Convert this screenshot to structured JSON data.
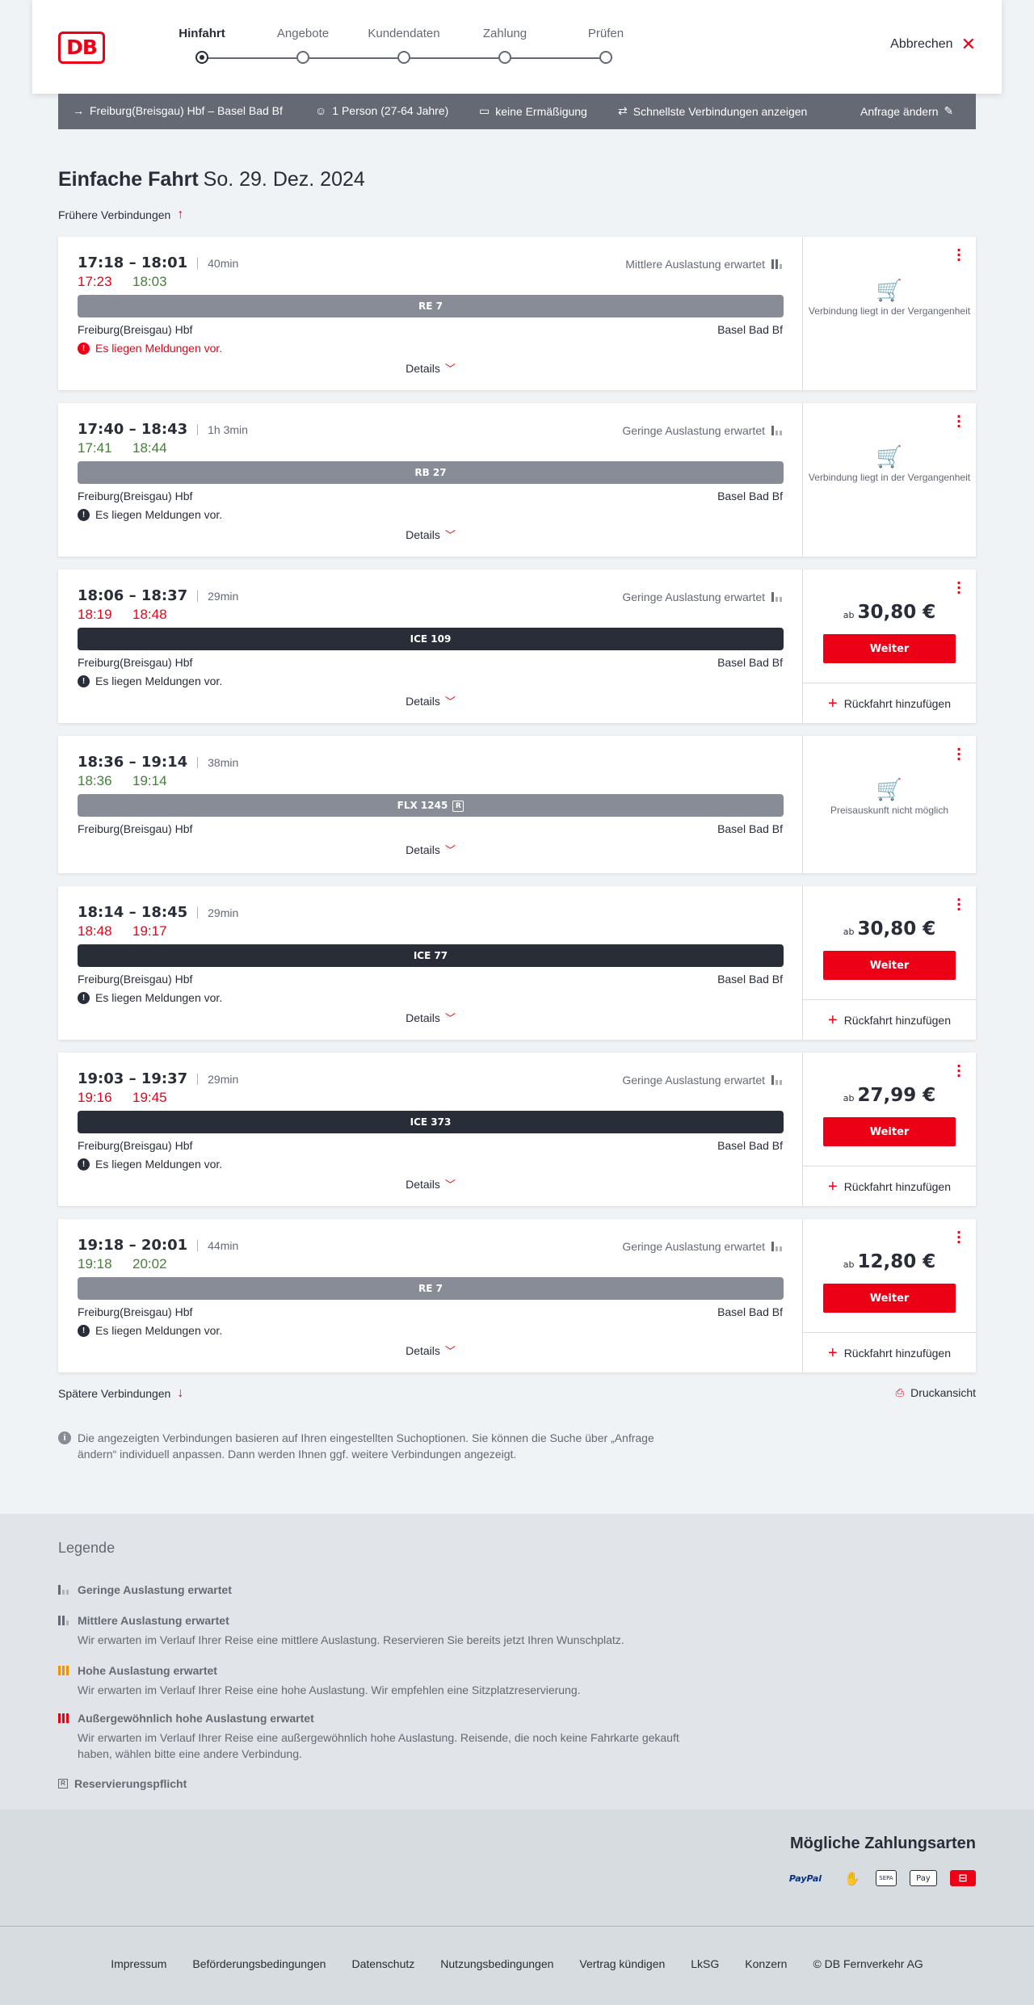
{
  "header": {
    "logo": "DB",
    "steps": [
      {
        "label": "Hinfahrt",
        "active": true
      },
      {
        "label": "Angebote",
        "active": false
      },
      {
        "label": "Kundendaten",
        "active": false
      },
      {
        "label": "Zahlung",
        "active": false
      },
      {
        "label": "Prüfen",
        "active": false
      }
    ],
    "cancel_label": "Abbrechen"
  },
  "summary": {
    "route": "Freiburg(Breisgau) Hbf – Basel Bad Bf",
    "persons": "1 Person (27-64 Jahre)",
    "discount": "keine Ermäßigung",
    "fastest": "Schnellste Verbindungen anzeigen",
    "change": "Anfrage ändern"
  },
  "title": {
    "type": "Einfache Fahrt",
    "date": "So. 29. Dez. 2024"
  },
  "earlier_label": "Frühere Verbindungen",
  "later_label": "Spätere Verbindungen",
  "print_label": "Druckansicht",
  "info_text": "Die angezeigten Verbindungen basieren auf Ihren eingestellten Suchoptionen. Sie können die Suche über „Anfrage ändern“ individuell anpassen. Dann werden Ihnen ggf. weitere Verbindungen angezeigt.",
  "common": {
    "details": "Details",
    "from": "Freiburg(Breisgau) Hbf",
    "to": "Basel Bad Bf",
    "message": "Es liegen Meldungen vor.",
    "ab": "ab",
    "weiter": "Weiter",
    "return": "Rückfahrt hinzufügen"
  },
  "connections": [
    {
      "times": "17:18 – 18:01",
      "duration": "40min",
      "rt_dep": "17:23",
      "rt_arr": "18:03",
      "dep_color": "red",
      "arr_color": "green",
      "load": "Mittlere Auslastung erwartet",
      "train": "RE 7",
      "train_style": "grey",
      "msg": true,
      "msg_alert": true,
      "status": "past",
      "status_text": "Verbindung liegt in der Vergangenheit"
    },
    {
      "times": "17:40 – 18:43",
      "duration": "1h 3min",
      "rt_dep": "17:41",
      "rt_arr": "18:44",
      "dep_color": "green",
      "arr_color": "green",
      "load": "Geringe Auslastung erwartet",
      "train": "RB 27",
      "train_style": "grey",
      "msg": true,
      "msg_alert": false,
      "status": "past",
      "status_text": "Verbindung liegt in der Vergangenheit"
    },
    {
      "times": "18:06 – 18:37",
      "duration": "29min",
      "rt_dep": "18:19",
      "rt_arr": "18:48",
      "dep_color": "red",
      "arr_color": "red",
      "load": "Geringe Auslastung erwartet",
      "train": "ICE 109",
      "train_style": "dark",
      "msg": true,
      "msg_alert": false,
      "status": "price",
      "price": "30,80 €"
    },
    {
      "times": "18:36 – 19:14",
      "duration": "38min",
      "rt_dep": "18:36",
      "rt_arr": "19:14",
      "dep_color": "green",
      "arr_color": "green",
      "load": "",
      "train": "FLX 1245",
      "train_style": "grey",
      "reservation": "R",
      "msg": false,
      "status": "past",
      "status_text": "Preisauskunft nicht möglich"
    },
    {
      "times": "18:14 – 18:45",
      "duration": "29min",
      "rt_dep": "18:48",
      "rt_arr": "19:17",
      "dep_color": "red",
      "arr_color": "red",
      "load": "",
      "train": "ICE 77",
      "train_style": "dark",
      "msg": true,
      "msg_alert": false,
      "status": "price",
      "price": "30,80 €"
    },
    {
      "times": "19:03 – 19:37",
      "duration": "29min",
      "rt_dep": "19:16",
      "rt_arr": "19:45",
      "dep_color": "red",
      "arr_color": "red",
      "load": "Geringe Auslastung erwartet",
      "train": "ICE 373",
      "train_style": "dark",
      "msg": true,
      "msg_alert": false,
      "status": "price",
      "price": "27,99 €"
    },
    {
      "times": "19:18 – 20:01",
      "duration": "44min",
      "rt_dep": "19:18",
      "rt_arr": "20:02",
      "dep_color": "green",
      "arr_color": "green",
      "load": "Geringe Auslastung erwartet",
      "train": "RE 7",
      "train_style": "grey",
      "msg": true,
      "msg_alert": false,
      "status": "price",
      "price": "12,80 €"
    }
  ],
  "legend": {
    "title": "Legende",
    "items": [
      {
        "title": "Geringe Auslastung erwartet",
        "desc": "",
        "color": "#646973"
      },
      {
        "title": "Mittlere Auslastung erwartet",
        "desc": "Wir erwarten im Verlauf Ihrer Reise eine mittlere Auslastung. Reservieren Sie bereits jetzt Ihren Wunschplatz.",
        "color": "#646973"
      },
      {
        "title": "Hohe Auslastung erwartet",
        "desc": "Wir erwarten im Verlauf Ihrer Reise eine hohe Auslastung. Wir empfehlen eine Sitzplatzreservierung.",
        "color": "#f39200"
      },
      {
        "title": "Außergewöhnlich hohe Auslastung erwartet",
        "desc": "Wir erwarten im Verlauf Ihrer Reise eine außergewöhnlich hohe Auslastung. Reisende, die noch keine Fahrkarte gekauft haben, wählen bitte eine andere Verbindung.",
        "color": "#ec0016"
      },
      {
        "title": "Reservierungspflicht",
        "desc": "",
        "color": "#646973"
      }
    ]
  },
  "payments": {
    "title": "Mögliche Zahlungsarten",
    "methods": [
      "PayPal",
      "SEPA",
      "Pay"
    ]
  },
  "footer": {
    "links": [
      "Impressum",
      "Beförderungsbedingungen",
      "Datenschutz",
      "Nutzungsbedingungen",
      "Vertrag kündigen",
      "LkSG",
      "Konzern",
      "© DB Fernverkehr AG"
    ]
  }
}
